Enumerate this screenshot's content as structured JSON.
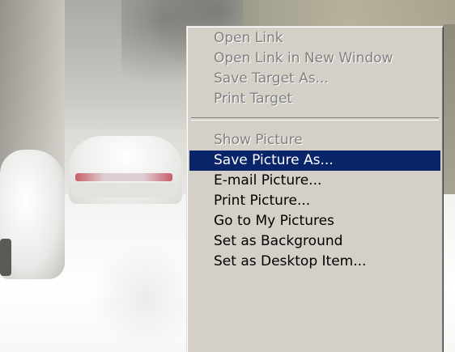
{
  "background": {
    "description_icon": "snowy-street-photo"
  },
  "context_menu": {
    "groups": [
      {
        "items": [
          {
            "label": "Open Link",
            "state": "disabled"
          },
          {
            "label": "Open Link in New Window",
            "state": "disabled"
          },
          {
            "label": "Save Target As...",
            "state": "disabled"
          },
          {
            "label": "Print Target",
            "state": "disabled"
          }
        ]
      },
      {
        "items": [
          {
            "label": "Show Picture",
            "state": "disabled"
          },
          {
            "label": "Save Picture As...",
            "state": "selected"
          },
          {
            "label": "E-mail Picture...",
            "state": "enabled"
          },
          {
            "label": "Print Picture...",
            "state": "enabled"
          },
          {
            "label": "Go to My Pictures",
            "state": "enabled"
          },
          {
            "label": "Set as Background",
            "state": "enabled"
          },
          {
            "label": "Set as Desktop Item...",
            "state": "enabled"
          }
        ]
      }
    ],
    "colors": {
      "menu_bg": "#d4d0c8",
      "highlight_bg": "#0a246a",
      "highlight_text": "#ffffff",
      "disabled_text": "#808080",
      "enabled_text": "#000000"
    }
  }
}
